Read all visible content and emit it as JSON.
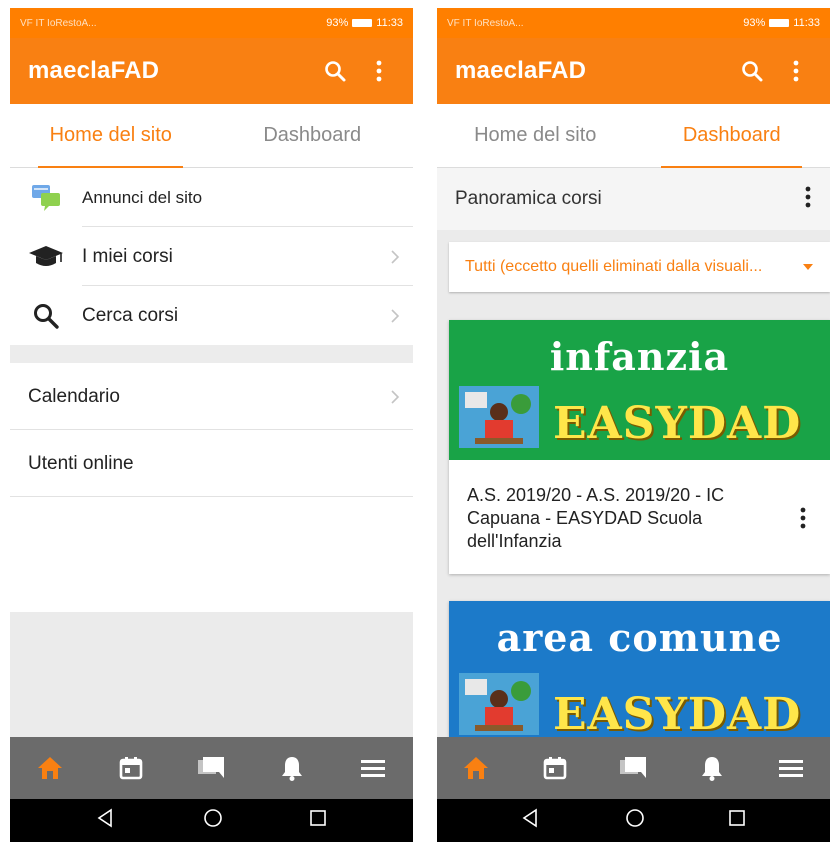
{
  "left": {
    "status": {
      "carrier": "VF IT IoRestoA...",
      "battery": "93%",
      "time": "11:33"
    },
    "app_title": "maeclaFAD",
    "tabs": [
      {
        "label": "Home del sito"
      },
      {
        "label": "Dashboard"
      }
    ],
    "items": [
      {
        "label": "Annunci del sito",
        "icon": "forum-icon"
      },
      {
        "label": "I miei corsi",
        "icon": "graduation-cap-icon"
      },
      {
        "label": "Cerca corsi",
        "icon": "search-icon"
      }
    ],
    "extra": [
      {
        "label": "Calendario"
      },
      {
        "label": "Utenti online"
      }
    ]
  },
  "right": {
    "status": {
      "carrier": "VF IT IoRestoA...",
      "battery": "93%",
      "time": "11:33"
    },
    "app_title": "maeclaFAD",
    "tabs": [
      {
        "label": "Home del sito"
      },
      {
        "label": "Dashboard"
      }
    ],
    "panorama_title": "Panoramica corsi",
    "filter_value": "Tutti (eccetto quelli eliminati dalla visuali...",
    "courses": [
      {
        "banner_top": "infanzia",
        "banner_bottom": "EASYDAD",
        "title": "A.S. 2019/20 - A.S. 2019/20 - IC Capuana - EASYDAD Scuola dell'Infanzia"
      },
      {
        "banner_top": "area comune",
        "banner_bottom": "EASYDAD"
      }
    ]
  },
  "bottom_nav": [
    "home-icon",
    "calendar-icon",
    "messages-icon",
    "bell-icon",
    "menu-icon"
  ],
  "colors": {
    "accent": "#f98012",
    "status_bar": "#ff7f00",
    "nav_bg": "#6b6b6b"
  }
}
